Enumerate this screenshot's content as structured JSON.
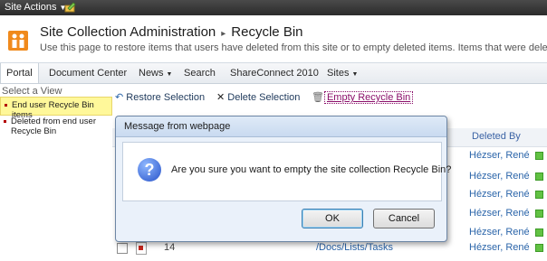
{
  "topbar": {
    "site_actions_label": "Site Actions"
  },
  "header": {
    "site_title": "Site Collection Administration",
    "page_title": "Recycle Bin",
    "description": "Use this page to restore items that users have deleted from this site or to empty deleted items.  Items that were deleted"
  },
  "nav": {
    "items": [
      {
        "label": "Portal"
      },
      {
        "label": "Document Center"
      },
      {
        "label": "News"
      },
      {
        "label": "Search"
      },
      {
        "label": "ShareConnect 2010"
      },
      {
        "label": "Sites"
      }
    ]
  },
  "leftnav": {
    "heading": "Select a View",
    "views": [
      {
        "label": "End user Recycle Bin items"
      },
      {
        "label": "Deleted from end user Recycle Bin"
      }
    ]
  },
  "toolbar": {
    "restore_label": "Restore Selection",
    "delete_label": "Delete Selection",
    "empty_label": "Empty Recycle Bin"
  },
  "grid": {
    "deleted_by_header": "Deleted By",
    "users": [
      "Hézser, René",
      "Hézser, René",
      "Hézser, René",
      "Hézser, René",
      "Hézser, René",
      "Hézser, René"
    ],
    "last_row": {
      "id": "14",
      "path": "/Docs/Lists/Tasks"
    }
  },
  "dialog": {
    "title": "Message from webpage",
    "message": "Are you sure you want to empty the site collection Recycle Bin?",
    "ok_label": "OK",
    "cancel_label": "Cancel"
  },
  "colors": {
    "topbar": "#2b2b2b",
    "link": "#2a64a9",
    "selected_view": "#fff89a",
    "presence": "#62c243"
  }
}
